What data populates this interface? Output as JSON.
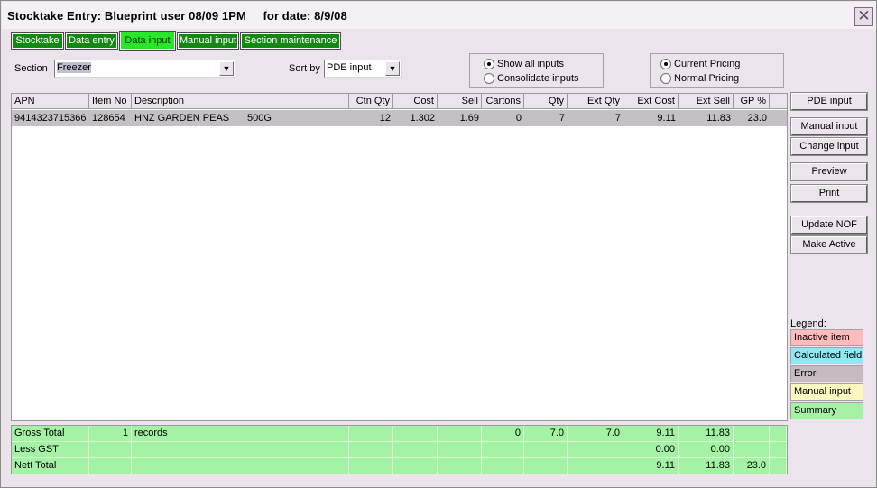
{
  "window": {
    "title": "Stocktake Entry: Blueprint user 08/09 1PM     for date: 8/9/08",
    "close_symbol": "✕"
  },
  "tabs": [
    "Stocktake",
    "Data entry",
    "Data input",
    "Manual input",
    "Section maintenance"
  ],
  "active_tab": "Data input",
  "section": {
    "label": "Section",
    "value": "Freezer"
  },
  "sort": {
    "label": "Sort by",
    "value": "PDE input"
  },
  "input_mode": {
    "options": [
      "Show all inputs",
      "Consolidate inputs"
    ],
    "selected": "Show all inputs"
  },
  "pricing": {
    "options": [
      "Current Pricing",
      "Normal Pricing"
    ],
    "selected": "Current Pricing"
  },
  "grid": {
    "columns": [
      "APN",
      "Item No",
      "Description",
      "Ctn Qty",
      "Cost",
      "Sell",
      "Cartons",
      "Qty",
      "Ext Qty",
      "Ext Cost",
      "Ext Sell",
      "GP %"
    ],
    "rows": [
      {
        "apn": "9414323715366",
        "item_no": "128654",
        "description": "HNZ GARDEN PEAS",
        "size": "500G",
        "ctn_qty": "12",
        "cost": "1.302",
        "sell": "1.69",
        "cartons": "0",
        "qty": "7",
        "ext_qty": "7",
        "ext_cost": "9.11",
        "ext_sell": "11.83",
        "gp": "23.0"
      }
    ]
  },
  "buttons": {
    "pde_input": "PDE input",
    "manual_input": "Manual input",
    "change_input": "Change input",
    "preview": "Preview",
    "print": "Print",
    "update_nof": "Update NOF",
    "make_active": "Make Active"
  },
  "legend": {
    "title": "Legend:",
    "items": [
      {
        "label": "Inactive item",
        "color": "#fcbcbc"
      },
      {
        "label": "Calculated field",
        "color": "#8ceaf4"
      },
      {
        "label": "Error",
        "color": "#c4bcc0"
      },
      {
        "label": "Manual input",
        "color": "#fcf8c0"
      },
      {
        "label": "Summary",
        "color": "#a4f2a4"
      }
    ]
  },
  "totals": {
    "gross": {
      "label": "Gross Total",
      "count": "1",
      "count_label": "records",
      "cartons": "0",
      "qty": "7.0",
      "ext_qty": "7.0",
      "ext_cost": "9.11",
      "ext_sell": "11.83",
      "gp": ""
    },
    "gst": {
      "label": "Less GST",
      "ext_cost": "0.00",
      "ext_sell": "0.00"
    },
    "nett": {
      "label": "Nett Total",
      "ext_cost": "9.11",
      "ext_sell": "11.83",
      "gp": "23.0"
    }
  }
}
